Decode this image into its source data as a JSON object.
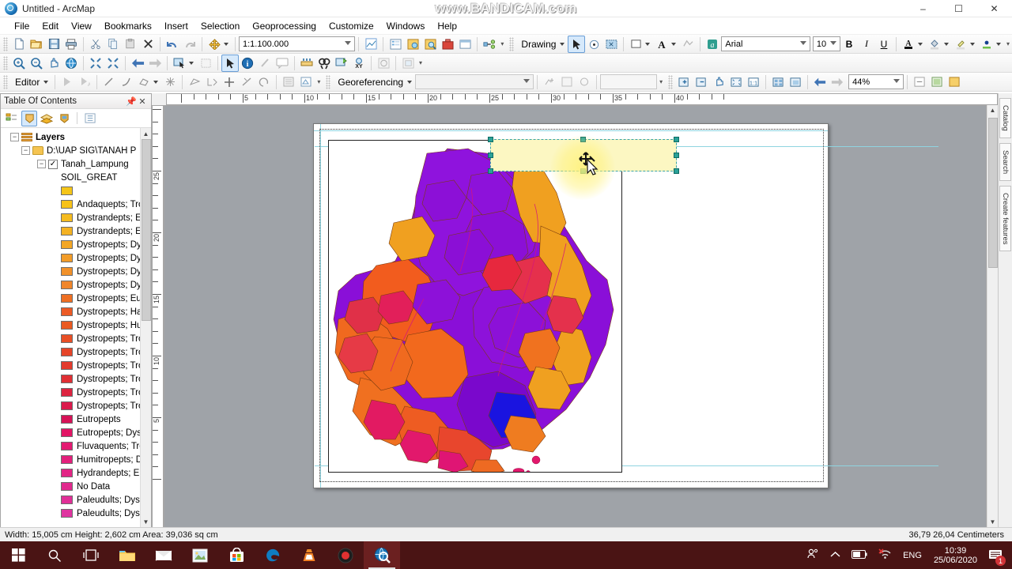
{
  "window": {
    "title": "Untitled - ArcMap",
    "app_icon": "arcmap-globe-icon",
    "watermark": "www.BANDICAM.com",
    "minimize": "–",
    "maximize": "☐",
    "close": "✕"
  },
  "menu": {
    "items": [
      "File",
      "Edit",
      "View",
      "Bookmarks",
      "Insert",
      "Selection",
      "Geoprocessing",
      "Customize",
      "Windows",
      "Help"
    ]
  },
  "standard_toolbar": {
    "scale_value": "1:1.100.000",
    "drawing_label": "Drawing",
    "font_name": "Arial",
    "font_size": "10",
    "bold": "B",
    "italic": "I",
    "underline": "U"
  },
  "georef_toolbar": {
    "editor_label": "Editor",
    "georeferencing_label": "Georeferencing",
    "zoom_percent": "44%"
  },
  "toc": {
    "title": "Table Of Contents",
    "pin_icon": "pin-icon",
    "close_icon": "close-icon",
    "tools": [
      "list-by-drawing-order-icon",
      "list-by-source-icon",
      "list-by-visibility-icon",
      "list-by-selection-icon",
      "options-icon"
    ],
    "root": "Layers",
    "folder": "D:\\UAP SIG\\TANAH P",
    "layer": "Tanah_Lampung",
    "field": "SOIL_GREAT",
    "legend": [
      {
        "label": "",
        "color": "#f5c518"
      },
      {
        "label": "Andaquepts; Tro",
        "color": "#f7c21a"
      },
      {
        "label": "Dystrandepts; E",
        "color": "#f5bb20"
      },
      {
        "label": "Dystrandepts; E",
        "color": "#f4b223"
      },
      {
        "label": "Dystropepts; Dy",
        "color": "#f3a726"
      },
      {
        "label": "Dystropepts; Dy",
        "color": "#f29c28"
      },
      {
        "label": "Dystropepts; Dy",
        "color": "#f1912a"
      },
      {
        "label": "Dystropepts; Dy",
        "color": "#f0862c"
      },
      {
        "label": "Dystropepts; Eu",
        "color": "#ee6f23"
      },
      {
        "label": "Dystropepts; Ha",
        "color": "#ec5a25"
      },
      {
        "label": "Dystropepts; Hu",
        "color": "#ea5a22"
      },
      {
        "label": "Dystropepts; Tro",
        "color": "#e84f26"
      },
      {
        "label": "Dystropepts; Tro",
        "color": "#e64529"
      },
      {
        "label": "Dystropepts; Tro",
        "color": "#e33b2e"
      },
      {
        "label": "Dystropepts; Tro",
        "color": "#e02f34"
      },
      {
        "label": "Dystropepts; Tro",
        "color": "#dd2440"
      },
      {
        "label": "Dystropepts; Tro",
        "color": "#da1a4c"
      },
      {
        "label": "Eutropepts",
        "color": "#d61257"
      },
      {
        "label": "Eutropepts; Dys",
        "color": "#e21565"
      },
      {
        "label": "Fluvaquents; Tro",
        "color": "#e31b72"
      },
      {
        "label": "Humitropepts; D",
        "color": "#e3207c"
      },
      {
        "label": "Hydrandepts; Eu",
        "color": "#e22585"
      },
      {
        "label": "No Data",
        "color": "#e12a8e"
      },
      {
        "label": "Paleudults; Dyst",
        "color": "#e02f97"
      },
      {
        "label": "Paleudults; Dyst",
        "color": "#df34a0"
      }
    ]
  },
  "layout": {
    "ruler_top_labels": [
      "5",
      "10",
      "15",
      "20",
      "25",
      "30",
      "35",
      "40"
    ],
    "ruler_left_labels": [
      "25",
      "20",
      "15",
      "10",
      "5"
    ],
    "selected_element_name": "legend-placeholder",
    "cursor": "move-cursor"
  },
  "view_tabs": {
    "data_view_icon": "data-view-icon",
    "layout_view_icon": "layout-view-icon",
    "refresh_icon": "refresh-icon",
    "pause_icon": "pause-drawing-icon",
    "back_icon": "previous-extent-icon"
  },
  "right_dock": {
    "tabs": [
      "Catalog",
      "Search",
      "Create features"
    ]
  },
  "status_bar": {
    "measurement": "Width: 15,005 cm  Height: 2,602 cm  Area: 39,036 sq cm",
    "coordinates": "36,79  26,04 Centimeters"
  },
  "taskbar": {
    "items": [
      "windows-start-icon",
      "search-icon",
      "task-view-icon",
      "file-explorer-icon",
      "mail-icon",
      "photos-icon",
      "microsoft-store-icon",
      "edge-icon",
      "vlc-icon",
      "bandicam-record-icon",
      "arcmap-icon"
    ],
    "tray": {
      "people_icon": "people-icon",
      "chevron_icon": "show-hidden-icons-icon",
      "battery_icon": "battery-icon",
      "network_icon": "network-disconnected-icon",
      "language": "ENG",
      "time": "10:39",
      "date": "25/06/2020",
      "notification_count": "1"
    }
  },
  "colors": {
    "accent": "#2aa198",
    "taskbar": "#4a1414",
    "selection_fill": "#fcf7c2"
  }
}
